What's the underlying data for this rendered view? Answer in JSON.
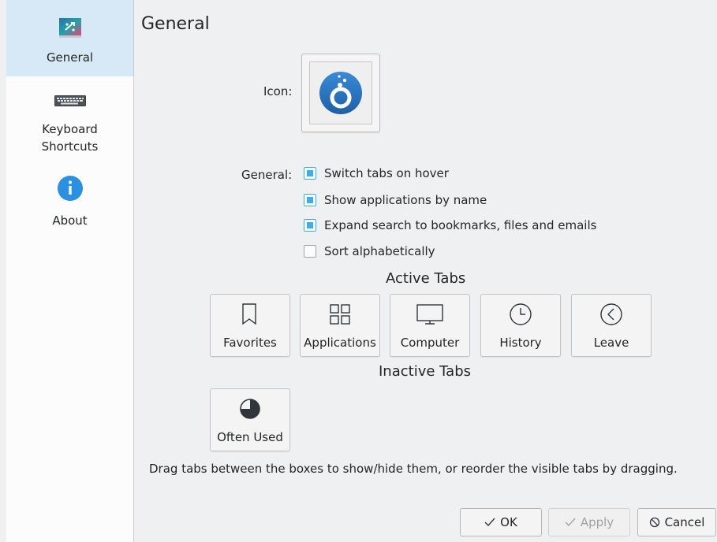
{
  "sidebar": {
    "items": [
      {
        "label": "General",
        "icon": "plasma-settings-icon",
        "selected": true
      },
      {
        "label": "Keyboard\nShortcuts",
        "icon": "keyboard-icon"
      },
      {
        "label": "About",
        "icon": "info-icon"
      }
    ]
  },
  "page": {
    "title": "General",
    "icon_label": "Icon:",
    "general_label": "General:",
    "options": [
      {
        "label": "Switch tabs on hover",
        "checked": true
      },
      {
        "label": "Show applications by name",
        "checked": true
      },
      {
        "label": "Expand search to bookmarks, files and emails",
        "checked": true
      },
      {
        "label": "Sort alphabetically",
        "checked": false
      }
    ],
    "active_tabs_title": "Active Tabs",
    "active_tabs": [
      {
        "label": "Favorites",
        "icon": "bookmark-icon"
      },
      {
        "label": "Applications",
        "icon": "applications-grid-icon"
      },
      {
        "label": "Computer",
        "icon": "computer-icon"
      },
      {
        "label": "History",
        "icon": "clock-icon"
      },
      {
        "label": "Leave",
        "icon": "leave-icon"
      }
    ],
    "inactive_tabs_title": "Inactive Tabs",
    "inactive_tabs": [
      {
        "label": "Often Used",
        "icon": "pie-chart-icon"
      }
    ],
    "hint": "Drag tabs between the boxes to show/hide them, or reorder the visible tabs by dragging."
  },
  "buttons": {
    "ok": "OK",
    "apply": "Apply",
    "cancel": "Cancel"
  },
  "colors": {
    "accent": "#3daee9",
    "sidebar_selected": "#d7e8f6",
    "kickoff_icon": "#2a77c5"
  }
}
